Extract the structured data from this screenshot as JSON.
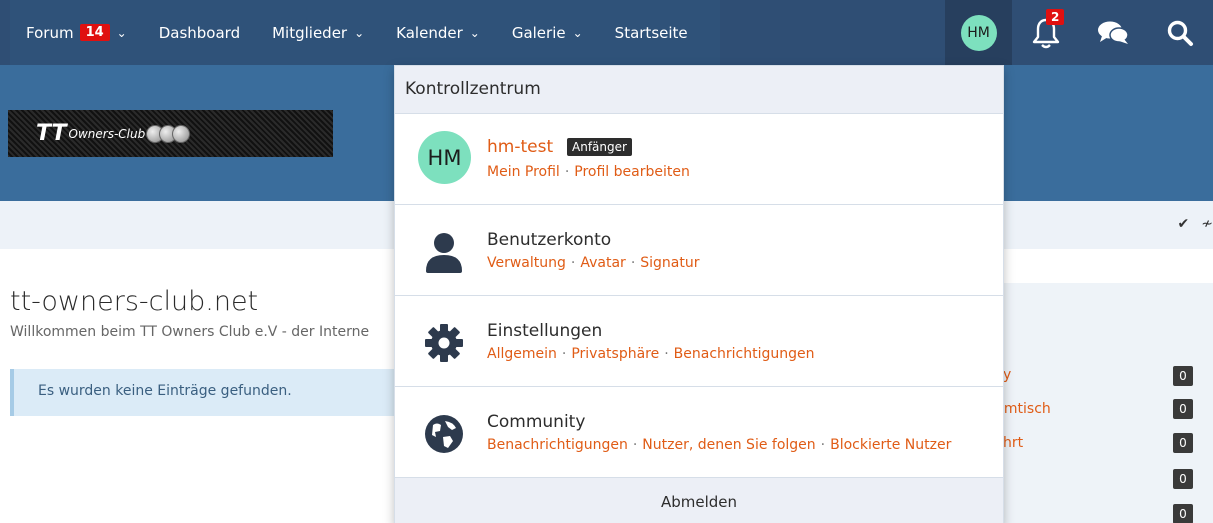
{
  "nav": {
    "items": [
      {
        "label": "Forum",
        "badge": "14",
        "dropdown": true
      },
      {
        "label": "Dashboard",
        "dropdown": false
      },
      {
        "label": "Mitglieder",
        "dropdown": true
      },
      {
        "label": "Kalender",
        "dropdown": true
      },
      {
        "label": "Galerie",
        "dropdown": true
      },
      {
        "label": "Startseite",
        "dropdown": false
      }
    ],
    "user_avatar_initials": "HM",
    "notifications_count": "2",
    "icons": [
      "bell-icon",
      "chat-icon",
      "search-icon"
    ]
  },
  "header": {
    "logo_brand": "TT",
    "logo_text": "Owners-Club"
  },
  "page": {
    "title": "tt-owners-club.net",
    "description": "Willkommen beim TT Owners Club e.V - der Interne",
    "notice": "Es wurden keine Einträge gefunden."
  },
  "sidebar": {
    "links": [
      "y",
      "ımtisch",
      "hrt"
    ],
    "counts": [
      "0",
      "0",
      "0",
      "0",
      "0"
    ]
  },
  "dropdown": {
    "header": "Kontrollzentrum",
    "user": {
      "initials": "HM",
      "name": "hm-test",
      "rank": "Anfänger",
      "links": [
        "Mein Profil",
        "Profil bearbeiten"
      ]
    },
    "sections": [
      {
        "title": "Benutzerkonto",
        "icon": "user-icon",
        "links": [
          "Verwaltung",
          "Avatar",
          "Signatur"
        ]
      },
      {
        "title": "Einstellungen",
        "icon": "gear-icon",
        "links": [
          "Allgemein",
          "Privatsphäre",
          "Benachrichtigungen"
        ]
      },
      {
        "title": "Community",
        "icon": "globe-icon",
        "links": [
          "Benachrichtigungen",
          "Nutzer, denen Sie folgen",
          "Blockierte Nutzer"
        ]
      }
    ],
    "footer": "Abmelden"
  },
  "colors": {
    "nav_bg": "#2f5279",
    "header_bg": "#3a6d9c",
    "link_accent": "#e05c16",
    "avatar_bg": "#7de0be"
  }
}
